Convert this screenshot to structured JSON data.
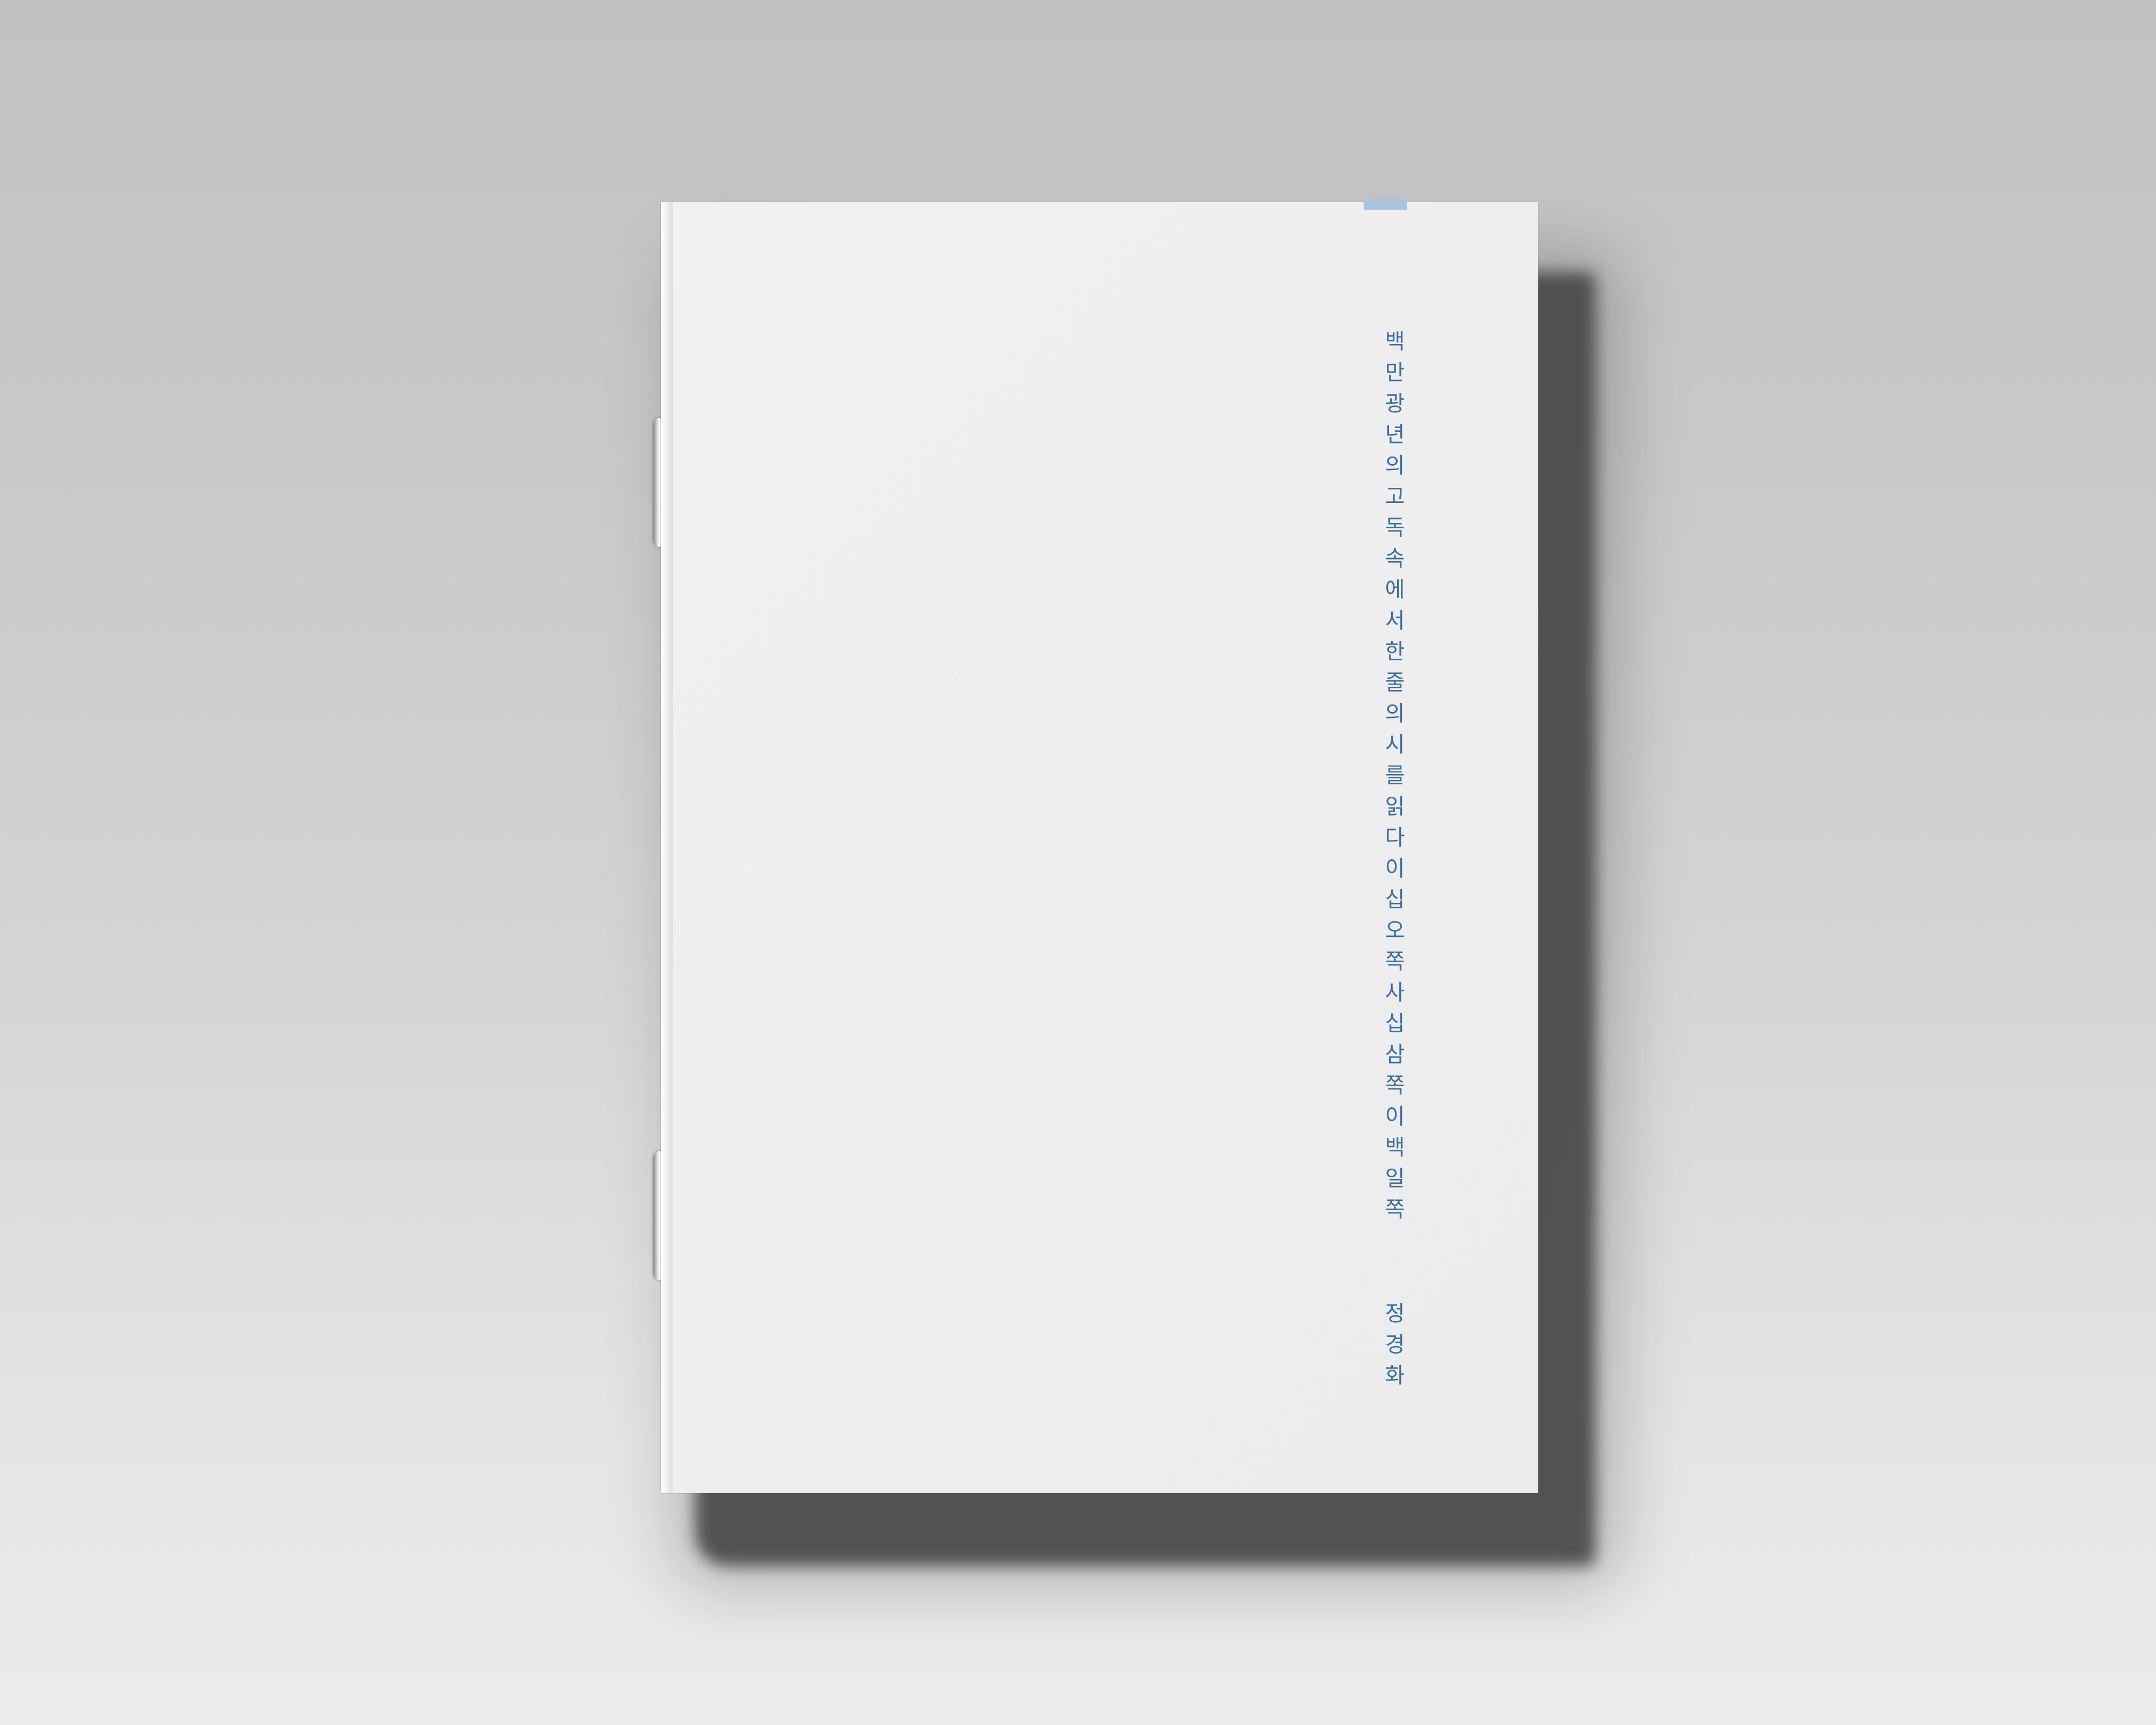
{
  "cover": {
    "title": "백만광년의고독속에서한줄의시를읽다이십오쪽사십삼쪽이백일쪽",
    "author": "정경화",
    "text_color": "#3d6e9e",
    "tab_color": "#a9c3de",
    "paper_color": "#eeeeee"
  },
  "scene": {
    "background_top": "#c2c2c2",
    "background_bottom": "#ececec",
    "shadow_color": "#4a4a4a"
  }
}
